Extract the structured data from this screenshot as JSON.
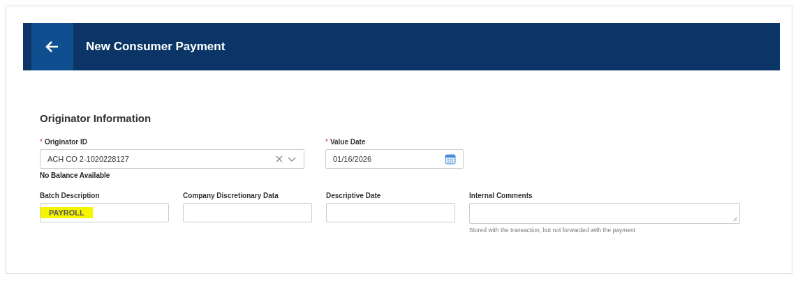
{
  "header": {
    "title": "New Consumer Payment"
  },
  "section": {
    "title": "Originator Information"
  },
  "row_1": [
    {
      "kind": "select",
      "label": "Originator ID",
      "required_mark": "*",
      "value": "ACH CO 2-1020228127",
      "note": "No Balance Available"
    },
    {
      "kind": "date",
      "label": "Value Date",
      "required_mark": "*",
      "value": "01/16/2026"
    }
  ],
  "row_2": [
    {
      "kind": "text",
      "label": "Batch Description",
      "value": "PAYROLL",
      "highlighted": true
    },
    {
      "kind": "text",
      "label": "Company Discretionary Data"
    },
    {
      "kind": "text",
      "label": "Descriptive Date"
    },
    {
      "kind": "textarea",
      "label": "Internal Comments",
      "hint": "Stored with the transaction, but not forwarded with the payment"
    }
  ]
}
